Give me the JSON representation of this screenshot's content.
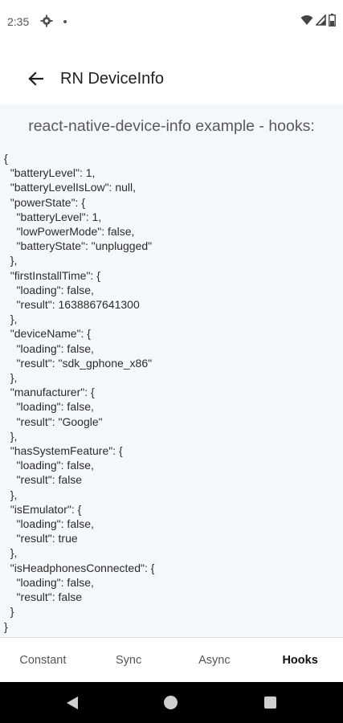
{
  "status_bar": {
    "time": "2:35",
    "icons": [
      "gear-icon",
      "dot-icon",
      "wifi-icon",
      "signal-icon",
      "battery-icon"
    ]
  },
  "app_bar": {
    "title": "RN DeviceInfo",
    "back_icon": "arrow-back-icon"
  },
  "content": {
    "heading": "react-native-device-info example - hooks:",
    "json_text": "{\n  \"batteryLevel\": 1,\n  \"batteryLevelIsLow\": null,\n  \"powerState\": {\n    \"batteryLevel\": 1,\n    \"lowPowerMode\": false,\n    \"batteryState\": \"unplugged\"\n  },\n  \"firstInstallTime\": {\n    \"loading\": false,\n    \"result\": 1638867641300\n  },\n  \"deviceName\": {\n    \"loading\": false,\n    \"result\": \"sdk_gphone_x86\"\n  },\n  \"manufacturer\": {\n    \"loading\": false,\n    \"result\": \"Google\"\n  },\n  \"hasSystemFeature\": {\n    \"loading\": false,\n    \"result\": false\n  },\n  \"isEmulator\": {\n    \"loading\": false,\n    \"result\": true\n  },\n  \"isHeadphonesConnected\": {\n    \"loading\": false,\n    \"result\": false\n  }\n}"
  },
  "tabs": [
    {
      "label": "Constant",
      "active": false
    },
    {
      "label": "Sync",
      "active": false
    },
    {
      "label": "Async",
      "active": false
    },
    {
      "label": "Hooks",
      "active": true
    }
  ],
  "nav_bar": {
    "icons": [
      "nav-back-icon",
      "nav-home-icon",
      "nav-recents-icon"
    ]
  },
  "colors": {
    "content_background": "#f4f8fb",
    "nav_background": "#000000",
    "active_tab_text": "#111111"
  }
}
